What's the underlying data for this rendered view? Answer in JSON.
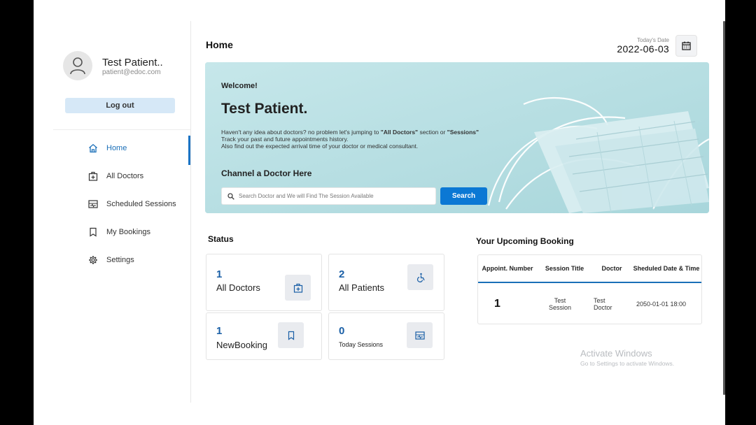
{
  "profile": {
    "name": "Test Patient..",
    "email": "patient@edoc.com",
    "logout_label": "Log out",
    "avatar_icon": "user-icon"
  },
  "sidebar": {
    "items": [
      {
        "label": "Home",
        "icon": "home-icon",
        "active": true
      },
      {
        "label": "All Doctors",
        "icon": "medical-bag-icon",
        "active": false
      },
      {
        "label": "Scheduled Sessions",
        "icon": "sessions-icon",
        "active": false
      },
      {
        "label": "My Bookings",
        "icon": "bookmark-icon",
        "active": false
      },
      {
        "label": "Settings",
        "icon": "gear-icon",
        "active": false
      }
    ]
  },
  "header": {
    "title": "Home",
    "date_caption": "Today's Date",
    "date_value": "2022-06-03",
    "calendar_icon": "calendar-icon"
  },
  "hero": {
    "welcome": "Welcome!",
    "name": "Test Patient.",
    "desc_line1_pre": "Haven't any idea about doctors? no problem let's jumping to ",
    "desc_line1_link1": "\"All Doctors\"",
    "desc_line1_mid": " section or ",
    "desc_line1_link2": "\"Sessions\"",
    "desc_line2": "Track your past and future appointments history.",
    "desc_line3": "Also find out the expected arrival time of your doctor or medical consultant.",
    "channel_title": "Channel a Doctor Here",
    "search_placeholder": "Search Doctor and We will Find The Session Available",
    "search_button": "Search"
  },
  "status": {
    "title": "Status",
    "cards": [
      {
        "value": "1",
        "label": "All Doctors",
        "icon": "medical-bag-icon"
      },
      {
        "value": "2",
        "label": "All Patients",
        "icon": "wheelchair-icon"
      },
      {
        "value": "1",
        "label": "NewBooking",
        "icon": "bookmark-icon"
      },
      {
        "value": "0",
        "label": "Today Sessions",
        "icon": "sessions-icon"
      }
    ]
  },
  "upcoming": {
    "title": "Your Upcoming Booking",
    "headers": [
      "Appoint. Number",
      "Session Title",
      "Doctor",
      "Sheduled Date & Time"
    ],
    "rows": [
      {
        "number": "1",
        "session": "Test Session",
        "doctor": "Test Doctor",
        "datetime": "2050-01-01 18:00"
      }
    ]
  },
  "watermark": {
    "line1": "Activate Windows",
    "line2": "Go to Settings to activate Windows."
  },
  "colors": {
    "accent": "#0b78d4",
    "accent_light": "#d6e8f7",
    "hero_bg": "#b9e0e4",
    "stat_number": "#1a5fa6"
  }
}
